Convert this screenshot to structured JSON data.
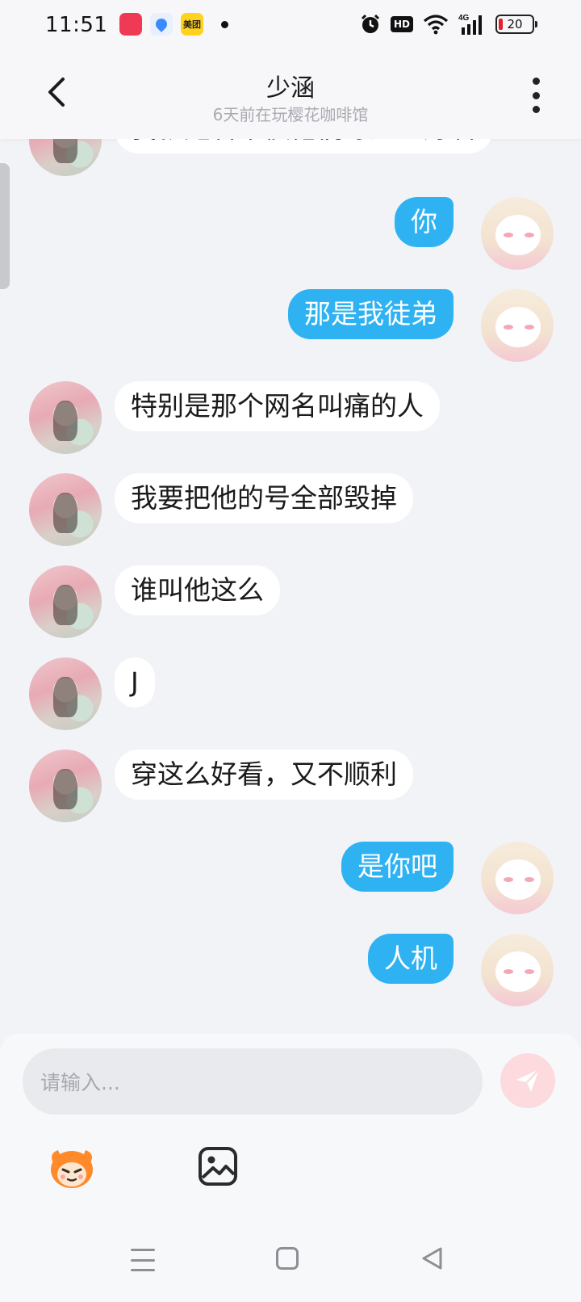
{
  "status_bar": {
    "time": "11:51",
    "apps": [
      {
        "name": "red-app-icon",
        "label": "",
        "color": "#f03a55"
      },
      {
        "name": "blue-app-icon",
        "label": "",
        "color": "#3a8bff"
      },
      {
        "name": "meituan-app-icon",
        "label": "美团",
        "color": "#ffd21f"
      }
    ],
    "hd": "HD",
    "network": "4G",
    "battery": "20",
    "battery_color": "#e3202b"
  },
  "header": {
    "title": "少涵",
    "subtitle": "6天前在玩樱花咖啡馆"
  },
  "messages": [
    {
      "side": "them",
      "text": "我就是看不惯他们穿这么好看"
    },
    {
      "side": "me",
      "text": "你"
    },
    {
      "side": "me",
      "text": "那是我徒弟"
    },
    {
      "side": "them",
      "text": "特别是那个网名叫痛的人"
    },
    {
      "side": "them",
      "text": "我要把他的号全部毁掉"
    },
    {
      "side": "them",
      "text": "谁叫他这么"
    },
    {
      "side": "them",
      "text": "J"
    },
    {
      "side": "them",
      "text": "穿这么好看，又不顺利"
    },
    {
      "side": "me",
      "text": "是你吧"
    },
    {
      "side": "me",
      "text": "人机"
    }
  ],
  "composer": {
    "placeholder": "请输入..."
  },
  "colors": {
    "my_bubble": "#2fb2f2",
    "their_bubble": "#ffffff",
    "send_button": "#fcdadd",
    "background": "#f2f3f7"
  },
  "icons": [
    "back-arrow-icon",
    "more-vertical-icon",
    "send-icon",
    "emoji-face-icon",
    "image-icon",
    "menu-nav-icon",
    "home-nav-icon",
    "back-nav-icon",
    "alarm-icon",
    "wifi-icon",
    "signal-icon",
    "battery-icon"
  ]
}
